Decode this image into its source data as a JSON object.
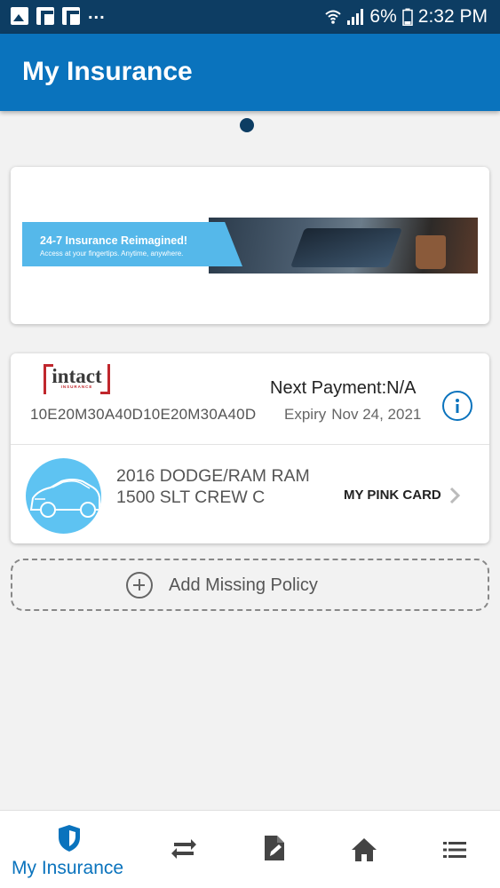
{
  "status_bar": {
    "battery": "6%",
    "time": "2:32 PM",
    "more": "..."
  },
  "header": {
    "title": "My Insurance"
  },
  "promo": {
    "headline": "24-7 Insurance Reimagined!",
    "subline": "Access at your fingertips. Anytime, anywhere."
  },
  "policy": {
    "insurer_logo": "intact",
    "insurer_logo_sub": "INSURANCE",
    "number": "10E20M30A40D10E20M30A40D",
    "next_payment": "Next Payment:N/A",
    "expiry_label": "Expiry",
    "expiry_date": "Nov 24, 2021",
    "vehicle_line1": "2016 DODGE/RAM RAM",
    "vehicle_line2": "1500 SLT CREW C",
    "pink_card_label": "MY PINK CARD"
  },
  "add_policy": {
    "label": "Add Missing Policy"
  },
  "bottom_nav": {
    "items": [
      {
        "label": "My Insurance",
        "icon": "shield-icon",
        "active": true
      },
      {
        "label": "",
        "icon": "repeat-icon",
        "active": false
      },
      {
        "label": "",
        "icon": "document-edit-icon",
        "active": false
      },
      {
        "label": "",
        "icon": "home-icon",
        "active": false
      },
      {
        "label": "",
        "icon": "list-icon",
        "active": false
      }
    ]
  },
  "colors": {
    "status_bar": "#0d3d63",
    "app_bar": "#0a73bd",
    "accent": "#0a73bd",
    "vehicle_avatar": "#5ec3f2",
    "promo_label": "#55b8ea",
    "logo_red": "#c0272d"
  }
}
